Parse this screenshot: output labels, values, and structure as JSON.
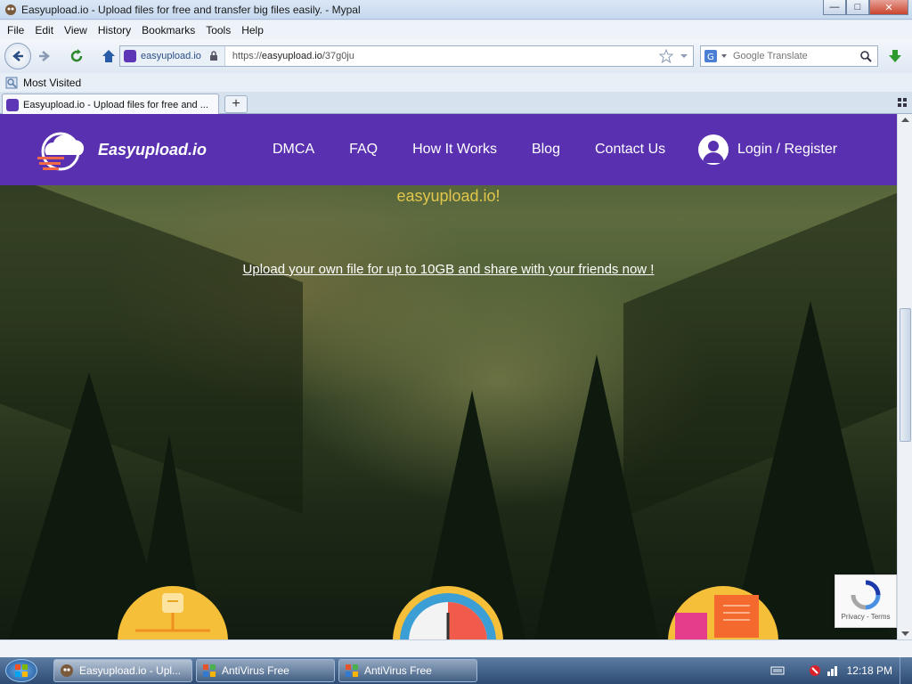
{
  "window": {
    "title": "Easyupload.io - Upload files for free and transfer big files easily. - Mypal",
    "min_glyph": "—",
    "max_glyph": "□",
    "close_glyph": "✕"
  },
  "menu": [
    "File",
    "Edit",
    "View",
    "History",
    "Bookmarks",
    "Tools",
    "Help"
  ],
  "navbar": {
    "site_identity": "easyupload.io",
    "url_prefix": "https://",
    "url_host": "easyupload.io",
    "url_path": "/37g0ju",
    "search_placeholder": "Google Translate"
  },
  "bookmarks": {
    "most_visited": "Most Visited"
  },
  "tabs": [
    {
      "label": "Easyupload.io - Upload files for free and ..."
    }
  ],
  "newtab_glyph": "+",
  "site": {
    "logo_text": "Easyupload.io",
    "nav": [
      "DMCA",
      "FAQ",
      "How It Works",
      "Blog",
      "Contact Us"
    ],
    "login_label": "Login / Register",
    "hero_brand": "easyupload.io!",
    "hero_tagline": "Upload your own file for up to 10GB and share with your friends now !"
  },
  "recaptcha": {
    "links": "Privacy - Terms"
  },
  "taskbar": {
    "tasks": [
      {
        "label": "Easyupload.io - Upl..."
      },
      {
        "label": "AntiVirus Free"
      },
      {
        "label": "AntiVirus Free"
      }
    ],
    "clock": "12:18 PM"
  },
  "colors": {
    "site_header": "#5930b0",
    "hero_brand": "#e2c64b",
    "feature_circle": "#f5bf3a"
  }
}
